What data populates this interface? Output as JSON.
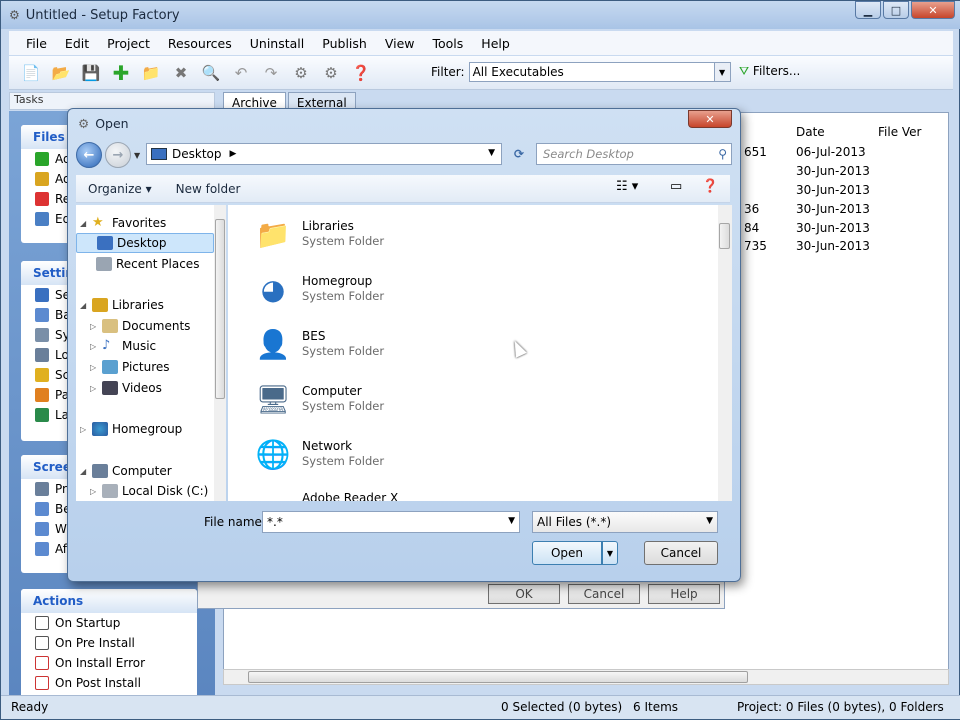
{
  "app": {
    "title": "Untitled - Setup Factory"
  },
  "menu": [
    "File",
    "Edit",
    "Project",
    "Resources",
    "Uninstall",
    "Publish",
    "View",
    "Tools",
    "Help"
  ],
  "toolbar": {
    "filter_label": "Filter:",
    "filter_value": "All Executables",
    "filters_button": "Filters..."
  },
  "tasks": {
    "header": "Tasks",
    "files": {
      "title": "Files",
      "items": [
        "Ad",
        "Ad",
        "Re",
        "Ed"
      ]
    },
    "settings": {
      "title": "Settin",
      "items": [
        "Se",
        "Ba",
        "Sy",
        "Lo",
        "Sc",
        "Pa",
        "La"
      ]
    },
    "screens": {
      "title": "Scree",
      "items": [
        "Pr",
        "Be",
        "W",
        "Af"
      ]
    },
    "actions": {
      "title": "Actions",
      "items": [
        "On Startup",
        "On Pre Install",
        "On Install Error",
        "On Post Install"
      ]
    }
  },
  "tabs": [
    "Archive",
    "External"
  ],
  "table": {
    "headers": [
      "Date",
      "File Ver"
    ],
    "rows": [
      {
        "size": "651",
        "date": "06-Jul-2013"
      },
      {
        "size": "",
        "date": "30-Jun-2013"
      },
      {
        "size": "",
        "date": "30-Jun-2013"
      },
      {
        "size": "36",
        "date": "30-Jun-2013"
      },
      {
        "size": "84",
        "date": "30-Jun-2013"
      },
      {
        "size": "735",
        "date": "30-Jun-2013"
      }
    ]
  },
  "bg_dialog": {
    "ok": "OK",
    "cancel": "Cancel",
    "help": "Help"
  },
  "status": {
    "ready": "Ready",
    "selected": "0 Selected (0 bytes)",
    "items": "6 Items",
    "project": "Project: 0 Files (0 bytes), 0 Folders"
  },
  "open_dialog": {
    "title": "Open",
    "address": "Desktop",
    "search_placeholder": "Search Desktop",
    "organize": "Organize",
    "new_folder": "New folder",
    "nav": {
      "favorites": "Favorites",
      "desktop": "Desktop",
      "recent": "Recent Places",
      "libraries": "Libraries",
      "documents": "Documents",
      "music": "Music",
      "pictures": "Pictures",
      "videos": "Videos",
      "homegroup": "Homegroup",
      "computer": "Computer",
      "local_disk": "Local Disk (C:)"
    },
    "items": [
      {
        "name": "Libraries",
        "type": "System Folder"
      },
      {
        "name": "Homegroup",
        "type": "System Folder"
      },
      {
        "name": "BES",
        "type": "System Folder"
      },
      {
        "name": "Computer",
        "type": "System Folder"
      },
      {
        "name": "Network",
        "type": "System Folder"
      },
      {
        "name": "Adobe Reader X",
        "type": ""
      }
    ],
    "file_name_label": "File name:",
    "file_name_value": "*.*",
    "file_type": "All Files (*.*)",
    "open_button": "Open",
    "cancel_button": "Cancel"
  }
}
